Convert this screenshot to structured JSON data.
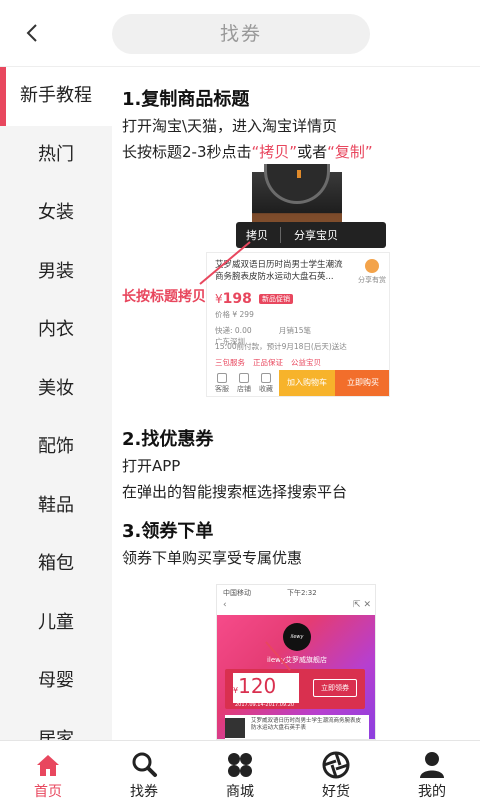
{
  "header": {
    "search_label": "找券"
  },
  "sidebar": {
    "items": [
      {
        "label": "新手教程",
        "active": true
      },
      {
        "label": "热门"
      },
      {
        "label": "女装"
      },
      {
        "label": "男装"
      },
      {
        "label": "内衣"
      },
      {
        "label": "美妆"
      },
      {
        "label": "配饰"
      },
      {
        "label": "鞋品"
      },
      {
        "label": "箱包"
      },
      {
        "label": "儿童"
      },
      {
        "label": "母婴"
      },
      {
        "label": "居家"
      }
    ]
  },
  "guide": {
    "step1": {
      "title": "1.复制商品标题",
      "line1": "打开淘宝\\天猫，进入淘宝详情页",
      "line2_prefix": "长按标题2-3秒点击",
      "line2_copy": "“拷贝”",
      "line2_or": "或者",
      "line2_copy2": "“复制”"
    },
    "illustration1": {
      "popup_copy": "拷贝",
      "popup_share": "分享宝贝",
      "label": "长按标题拷贝",
      "product_title": "艾罗威双语日历时尚男士学生潮流商务腕表皮防水运动大盘石英...",
      "share": "分享有赏",
      "price_symbol": "¥",
      "price": "198",
      "price_tag": "新品促销",
      "orig_price": "价格 ¥ 299",
      "shipping": "快递: 0.00",
      "monthly": "月销15笔",
      "location": "广东深圳",
      "delivery": "15:00前付款，预计9月18日(后天)送达",
      "services": [
        "三包服务",
        "正品保证",
        "公益宝贝"
      ],
      "bar_icons": [
        "客服",
        "店铺",
        "收藏"
      ],
      "add_cart": "加入购物车",
      "buy_now": "立即购买"
    },
    "step2": {
      "title": "2.找优惠券",
      "line1": "打开APP",
      "line2": "在弹出的智能搜索框选择搜索平台"
    },
    "step3": {
      "title": "3.领券下单",
      "line1": "领券下单购买享受专属优惠"
    },
    "illustration2": {
      "carrier": "中国移动",
      "time": "下午2:32",
      "logo": "ilewy",
      "store": "ilewy艾罗威旗舰店",
      "coupon_symbol": "¥",
      "coupon_value": "120",
      "coupon_date": "2017.09.14-2017.09.20",
      "coupon_button": "立即领券",
      "product_title": "艾罗威双语日历时尚男士学生潮流商务腕表皮防水运动大盘石英手表"
    }
  },
  "bottom_nav": {
    "tabs": [
      {
        "label": "首页",
        "icon": "home-icon",
        "active": true
      },
      {
        "label": "找券",
        "icon": "search-icon"
      },
      {
        "label": "商城",
        "icon": "grid-icon"
      },
      {
        "label": "好货",
        "icon": "aperture-icon"
      },
      {
        "label": "我的",
        "icon": "user-icon"
      }
    ]
  },
  "colors": {
    "accent": "#e8475e",
    "sidebar_bg": "#f4f4f4"
  }
}
